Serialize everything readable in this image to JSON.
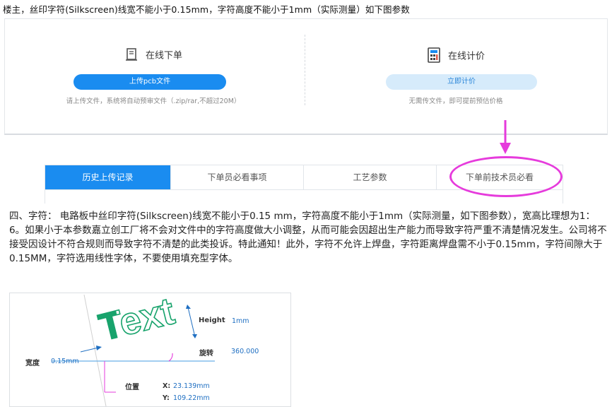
{
  "note": "楼主，丝印字符(Silkscreen)线宽不能小于0.15mm，字符高度不能小于1mm（实际测量）如下图参数",
  "order_panel": {
    "left": {
      "title": "在线下单",
      "icon": "document-icon",
      "button": "上传pcb文件",
      "hint": "请上传文件，系统将自动预审文件（.zip/rar,不超过20M）"
    },
    "right": {
      "title": "在线计价",
      "icon": "calculator-icon",
      "button": "立即计价",
      "hint": "无需传文件，即可提前预估价格"
    }
  },
  "tabs": [
    {
      "label": "历史上传记录",
      "active": true
    },
    {
      "label": "下单员必看事项",
      "active": false
    },
    {
      "label": "工艺参数",
      "active": false
    },
    {
      "label": "下单前技术员必看",
      "active": false
    }
  ],
  "annotation_color": "#e63bdc",
  "accent_color": "#1a8cf0",
  "paragraph": "四、字符： 电路板中丝印字符(Silkscreen)线宽不能小于0.15 mm，字符高度不能小于1mm（实际测量，如下图参数），宽高比理想为1：6。如果小于本参数嘉立创工厂将不会对文件中的字符高度做大小调整，从而可能会因超出生产能力而导致字符严重不清楚情况发生。公司将不接受因设计不符合规则而导致字符不清楚的此类投诉。特此通知！此外，字符不允许上焊盘，字符距离焊盘需不小于0.15mm，字符间隙大于0.15MM，字符选用线性字体，不要使用填充型字体。",
  "figure": {
    "sample_text": "Text",
    "height_label": "Height",
    "height_value": "1mm",
    "rotation_label": "旋转",
    "rotation_value": "360.000",
    "width_label": "宽度",
    "width_value": "0.15mm",
    "position_label": "位置",
    "x_label": "X:",
    "x_value": "23.139mm",
    "y_label": "Y:",
    "y_value": "109.22mm"
  }
}
